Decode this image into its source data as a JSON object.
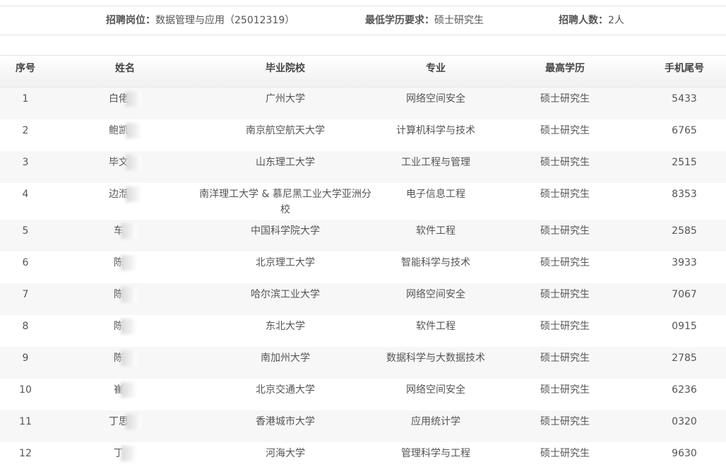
{
  "info": {
    "position_label": "招聘岗位：",
    "position_value": "数据管理与应用（25012319）",
    "education_label": "最低学历要求：",
    "education_value": "硕士研究生",
    "count_label": "招聘人数：",
    "count_value": "2人"
  },
  "table": {
    "headers": [
      "序号",
      "姓名",
      "毕业院校",
      "专业",
      "最高学历",
      "手机尾号"
    ],
    "rows": [
      {
        "seq": "1",
        "name": "白佬",
        "school": "广州大学",
        "major": "网络空间安全",
        "degree": "硕士研究生",
        "phone": "5433"
      },
      {
        "seq": "2",
        "name": "鲍凯",
        "school": "南京航空航天大学",
        "major": "计算机科学与技术",
        "degree": "硕士研究生",
        "phone": "6765"
      },
      {
        "seq": "3",
        "name": "毕文",
        "school": "山东理工大学",
        "major": "工业工程与管理",
        "degree": "硕士研究生",
        "phone": "2515"
      },
      {
        "seq": "4",
        "name": "边湉",
        "school": "南洋理工大学 & 慕尼黑工业大学亚洲分校",
        "major": "电子信息工程",
        "degree": "硕士研究生",
        "phone": "8353"
      },
      {
        "seq": "5",
        "name": "车",
        "school": "中国科学院大学",
        "major": "软件工程",
        "degree": "硕士研究生",
        "phone": "2585"
      },
      {
        "seq": "6",
        "name": "陈",
        "school": "北京理工大学",
        "major": "智能科学与技术",
        "degree": "硕士研究生",
        "phone": "3933"
      },
      {
        "seq": "7",
        "name": "陈",
        "school": "哈尔滨工业大学",
        "major": "网络空间安全",
        "degree": "硕士研究生",
        "phone": "7067"
      },
      {
        "seq": "8",
        "name": "陈",
        "school": "东北大学",
        "major": "软件工程",
        "degree": "硕士研究生",
        "phone": "0915"
      },
      {
        "seq": "9",
        "name": "陈",
        "school": "南加州大学",
        "major": "数据科学与大数据技术",
        "degree": "硕士研究生",
        "phone": "2785"
      },
      {
        "seq": "10",
        "name": "崔",
        "school": "北京交通大学",
        "major": "网络空间安全",
        "degree": "硕士研究生",
        "phone": "6236"
      },
      {
        "seq": "11",
        "name": "丁思",
        "school": "香港城市大学",
        "major": "应用统计学",
        "degree": "硕士研究生",
        "phone": "0320"
      },
      {
        "seq": "12",
        "name": "丁",
        "school": "河海大学",
        "major": "管理科学与工程",
        "degree": "硕士研究生",
        "phone": "9630"
      }
    ]
  }
}
